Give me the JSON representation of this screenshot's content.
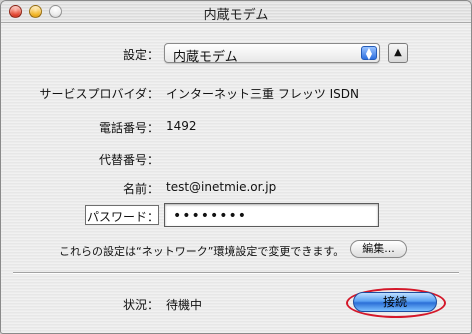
{
  "window": {
    "title": "内蔵モデム"
  },
  "form": {
    "settings_label": "設定：",
    "settings_value": "内蔵モデム",
    "toggle_symbol": "▲",
    "provider_label": "サービスプロバイダ：",
    "provider_value": "インターネット三重 フレッツ ISDN",
    "phone_label": "電話番号：",
    "phone_value": "1492",
    "alt_phone_label": "代替番号：",
    "alt_phone_value": "",
    "name_label": "名前：",
    "name_value": "test@inetmie.or.jp",
    "password_label": "パスワード：",
    "password_value": "••••••••",
    "note": "これらの設定は“ネットワーク”環境設定で変更できます。",
    "edit_button": "編集..."
  },
  "status": {
    "label": "状況：",
    "value": "待機中",
    "connect_button": "接続"
  },
  "colors": {
    "highlight_ring": "#d4182a",
    "aqua_blue": "#2b6fd7"
  }
}
